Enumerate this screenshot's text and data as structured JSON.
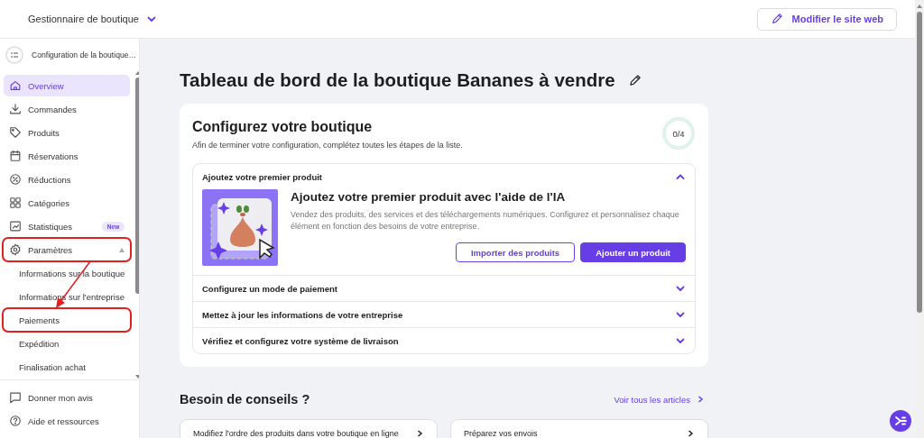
{
  "header": {
    "store_switcher": "Gestionnaire de boutique",
    "edit_button": "Modifier le site web"
  },
  "sidebar": {
    "setup": "Configuration de la boutique…",
    "items": [
      {
        "label": "Overview",
        "selected": true,
        "highlighted": false
      },
      {
        "label": "Commandes",
        "selected": false,
        "highlighted": false
      },
      {
        "label": "Produits",
        "selected": false,
        "highlighted": false
      },
      {
        "label": "Réservations",
        "selected": false,
        "highlighted": false
      },
      {
        "label": "Réductions",
        "selected": false,
        "highlighted": false
      },
      {
        "label": "Catégories",
        "selected": false,
        "highlighted": false
      },
      {
        "label": "Statistiques",
        "selected": false,
        "highlighted": false,
        "badge": "New"
      },
      {
        "label": "Paramètres",
        "selected": false,
        "highlighted": true,
        "expanded": true,
        "children": [
          {
            "label": "Informations sur la boutique",
            "selected": false,
            "highlighted": false
          },
          {
            "label": "Informations sur l'entreprise",
            "selected": false,
            "highlighted": false
          },
          {
            "label": "Paiements",
            "selected": false,
            "highlighted": true
          },
          {
            "label": "Expédition",
            "selected": false,
            "highlighted": false
          },
          {
            "label": "Finalisation achat",
            "selected": false,
            "highlighted": false
          }
        ]
      }
    ],
    "footer": [
      {
        "label": "Donner mon avis"
      },
      {
        "label": "Aide et ressources"
      }
    ]
  },
  "main": {
    "title": "Tableau de bord de la boutique Bananes à vendre",
    "setup_card": {
      "title": "Configurez votre boutique",
      "subtitle": "Afin de terminer votre configuration, complétez toutes les étapes de la liste.",
      "progress": "0/4",
      "level": 0,
      "steps": [
        {
          "title": "Ajoutez votre premier produit",
          "expanded": true,
          "heading": "Ajoutez votre premier produit avec l'aide de l'IA",
          "text": "Vendez des produits, des services et des téléchargements numériques. Configurez et personnalisez chaque élément en fonction des besoins de votre entreprise.",
          "buttons": [
            {
              "label": "Importer des produits",
              "kind": "secondary"
            },
            {
              "label": "Ajouter un produit",
              "kind": "primary"
            }
          ]
        },
        {
          "title": "Configurez un mode de paiement",
          "expanded": false
        },
        {
          "title": "Mettez à jour les informations de votre entreprise",
          "expanded": false
        },
        {
          "title": "Vérifiez et configurez votre système de livraison",
          "expanded": false
        }
      ]
    },
    "tips": {
      "title": "Besoin de conseils ?",
      "link": "Voir tous les articles",
      "articles": [
        {
          "title": "Modifiez l'ordre des produits dans votre boutique en ligne"
        },
        {
          "title": "Préparez vos envois"
        }
      ]
    }
  }
}
